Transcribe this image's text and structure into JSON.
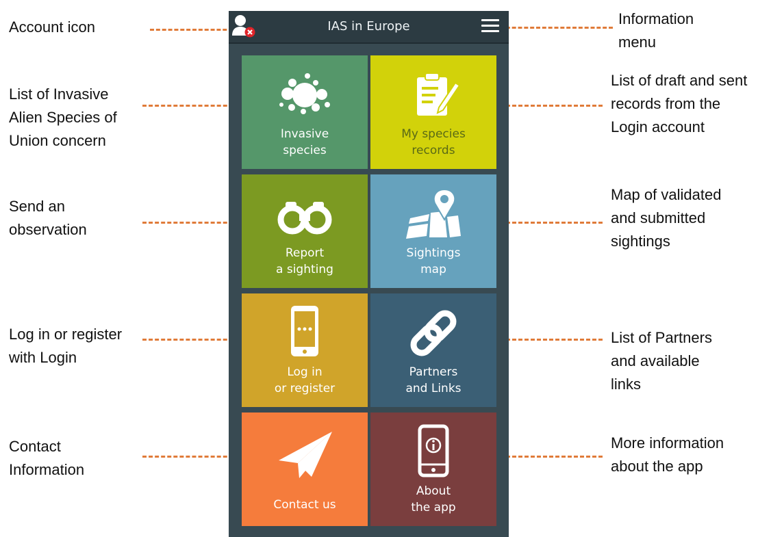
{
  "app": {
    "title": "IAS in Europe"
  },
  "header": {
    "account_icon": "account-icon",
    "menu_icon": "hamburger-menu-icon"
  },
  "tiles": [
    {
      "lines": [
        "Invasive",
        "species"
      ],
      "color": "#55976a",
      "icon": "bubbles-icon"
    },
    {
      "lines": [
        "My species",
        "records"
      ],
      "color": "#d2d20a",
      "text_color": "#5a6a16",
      "icon": "clipboard-icon"
    },
    {
      "lines": [
        "Report",
        "a sighting"
      ],
      "color": "#7c9a22",
      "icon": "binoculars-icon"
    },
    {
      "lines": [
        "Sightings",
        "map"
      ],
      "color": "#66a2bd",
      "icon": "map-pin-icon"
    },
    {
      "lines": [
        "Log in",
        "or register"
      ],
      "color": "#d0a42a",
      "icon": "smartphone-icon"
    },
    {
      "lines": [
        "Partners",
        "and Links"
      ],
      "color": "#3b5f75",
      "icon": "chain-link-icon"
    },
    {
      "lines": [
        "Contact us"
      ],
      "color": "#f57c3c",
      "icon": "paper-plane-icon"
    },
    {
      "lines": [
        "About",
        "the app"
      ],
      "color": "#7a3e3e",
      "icon": "phone-info-icon"
    }
  ],
  "annotations": {
    "account": [
      "Account icon"
    ],
    "menu": [
      "Information",
      "menu"
    ],
    "invasive": [
      "List of Invasive",
      "Alien Species of",
      "Union concern"
    ],
    "records": [
      "List of draft and sent",
      "records from the",
      "Login account"
    ],
    "report": [
      "Send an",
      "observation"
    ],
    "map": [
      "Map of validated",
      "and submitted",
      "sightings"
    ],
    "login": [
      "Log in or register",
      "with Login"
    ],
    "partners": [
      "List of Partners",
      "and available",
      "links"
    ],
    "contact": [
      "Contact",
      "Information"
    ],
    "about": [
      "More information",
      "about the app"
    ]
  },
  "colors": {
    "leader": "#e07b39",
    "phone_bg": "#384a52",
    "topbar": "#2c3b42"
  }
}
